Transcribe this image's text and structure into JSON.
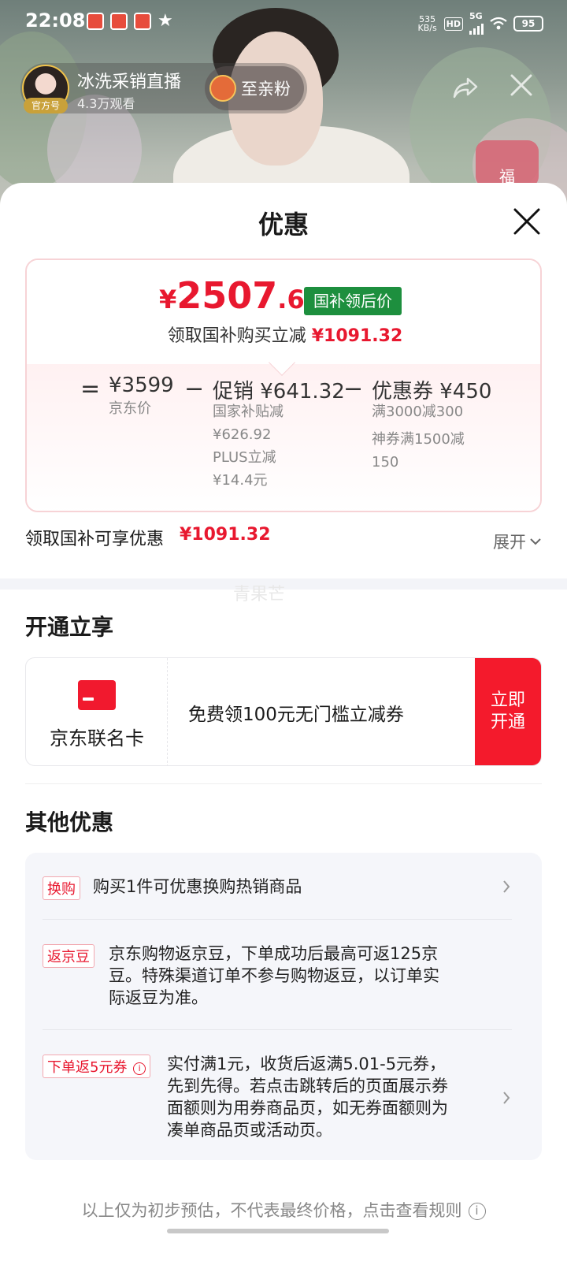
{
  "status_bar": {
    "time": "22:08",
    "net_speed": "535\nKB/s",
    "hd": "HD",
    "signal": "5G",
    "battery": "95"
  },
  "stream": {
    "anchor_name": "冰洗采销直播",
    "official_tag": "官方号",
    "views": "4.3万观看",
    "fan_label": "至亲粉",
    "fu_label": "福"
  },
  "sheet": {
    "title": "优惠"
  },
  "price_card": {
    "yuan": "¥",
    "final_int": "2507",
    "final_dec": ".68",
    "final_tag": "国补领后价",
    "subtitle_prefix": "领取国补购买立减",
    "subtitle_amount": "¥1091.32",
    "eq": "=",
    "minus": "−",
    "jd_price": "¥3599",
    "jd_price_label": "京东价",
    "promo_value": "促销 ¥641.32",
    "promo_notes": [
      "国家补贴减",
      "¥626.92",
      "PLUS立减",
      "¥14.4元"
    ],
    "coupon_value": "优惠券 ¥450",
    "coupon_notes": [
      "满3000减300",
      "神券满1500减",
      "150"
    ]
  },
  "total": {
    "label": "领取国补可享优惠",
    "value": "¥1091.32",
    "expand": "展开"
  },
  "watermark": "青果芒",
  "open_section": {
    "title": "开通立享",
    "card_name": "京东联名卡",
    "desc": "免费领100元无门槛立减券",
    "button": "立即\n开通"
  },
  "other_section": {
    "title": "其他优惠",
    "items": [
      {
        "tag": "换购",
        "text": "购买1件可优惠换购热销商品"
      },
      {
        "tag": "返京豆",
        "text": "京东购物返京豆，下单成功后最高可返125京\n豆。特殊渠道订单不参与购物返豆，以订单实\n际返豆为准。"
      },
      {
        "tag": "下单返5元券",
        "text": "实付满1元，收货后返满5.01-5元券，\n先到先得。若点击跳转后的页面展示券\n面额则为用券商品页，如无券面额则为\n凑单商品页或活动页。"
      }
    ]
  },
  "footer": {
    "note": "以上仅为初步预估，不代表最终价格，点击查看规则",
    "info_icon": "i"
  },
  "colors": {
    "accent_red": "#e8182f",
    "tag_green": "#1d8f3e",
    "button_red": "#f41a2c"
  }
}
